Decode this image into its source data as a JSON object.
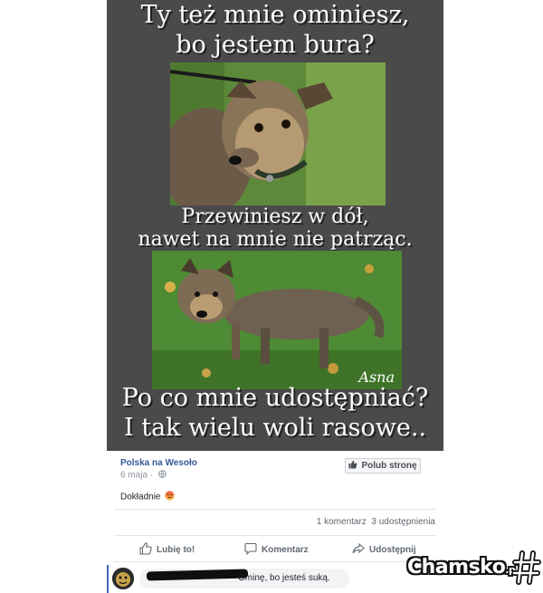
{
  "meme": {
    "line1": "Ty też mnie ominiesz,",
    "line2": "bo jestem bura?",
    "line3": "Przewiniesz w dół,",
    "line4": "nawet na mnie nie patrząc.",
    "line5": "Po co mnie udostępniać?",
    "line6": "I tak wielu woli rasowe..",
    "signature": "Asna"
  },
  "post": {
    "page_name": "Polska na Wesoło",
    "date": "6 maja ·",
    "like_page_label": "Polub stronę",
    "text": "Dokładnie",
    "comments_count": "1 komentarz",
    "shares_count": "3 udostępnienia",
    "actions": {
      "like": "Lubię to!",
      "comment": "Komentarz",
      "share": "Udostępnij"
    }
  },
  "comment": {
    "text": "Ominę, bo jesteś suką."
  },
  "watermark": {
    "brand": "Chamsko",
    "suffix": ".pl"
  },
  "colors": {
    "meme_bg": "#4a4a4a",
    "link": "#365899",
    "muted": "#606770"
  }
}
